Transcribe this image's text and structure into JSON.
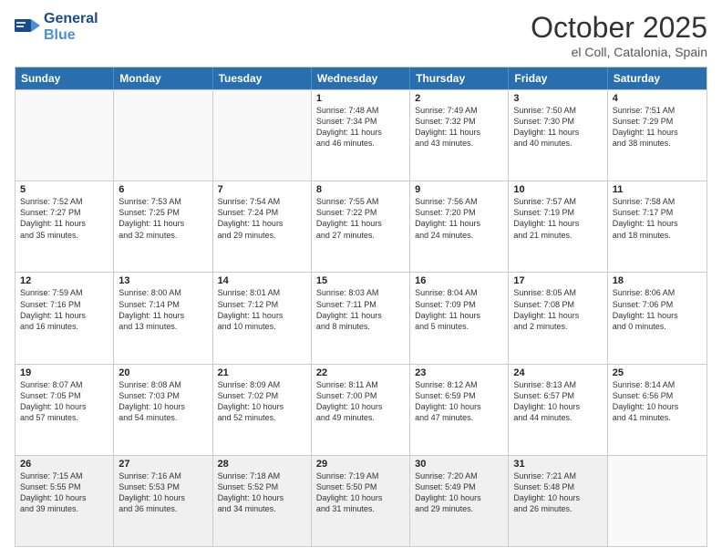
{
  "header": {
    "logo_line1": "General",
    "logo_line2": "Blue",
    "month": "October 2025",
    "location": "el Coll, Catalonia, Spain"
  },
  "weekdays": [
    "Sunday",
    "Monday",
    "Tuesday",
    "Wednesday",
    "Thursday",
    "Friday",
    "Saturday"
  ],
  "rows": [
    [
      {
        "num": "",
        "info": "",
        "empty": true
      },
      {
        "num": "",
        "info": "",
        "empty": true
      },
      {
        "num": "",
        "info": "",
        "empty": true
      },
      {
        "num": "1",
        "info": "Sunrise: 7:48 AM\nSunset: 7:34 PM\nDaylight: 11 hours\nand 46 minutes."
      },
      {
        "num": "2",
        "info": "Sunrise: 7:49 AM\nSunset: 7:32 PM\nDaylight: 11 hours\nand 43 minutes."
      },
      {
        "num": "3",
        "info": "Sunrise: 7:50 AM\nSunset: 7:30 PM\nDaylight: 11 hours\nand 40 minutes."
      },
      {
        "num": "4",
        "info": "Sunrise: 7:51 AM\nSunset: 7:29 PM\nDaylight: 11 hours\nand 38 minutes."
      }
    ],
    [
      {
        "num": "5",
        "info": "Sunrise: 7:52 AM\nSunset: 7:27 PM\nDaylight: 11 hours\nand 35 minutes."
      },
      {
        "num": "6",
        "info": "Sunrise: 7:53 AM\nSunset: 7:25 PM\nDaylight: 11 hours\nand 32 minutes."
      },
      {
        "num": "7",
        "info": "Sunrise: 7:54 AM\nSunset: 7:24 PM\nDaylight: 11 hours\nand 29 minutes."
      },
      {
        "num": "8",
        "info": "Sunrise: 7:55 AM\nSunset: 7:22 PM\nDaylight: 11 hours\nand 27 minutes."
      },
      {
        "num": "9",
        "info": "Sunrise: 7:56 AM\nSunset: 7:20 PM\nDaylight: 11 hours\nand 24 minutes."
      },
      {
        "num": "10",
        "info": "Sunrise: 7:57 AM\nSunset: 7:19 PM\nDaylight: 11 hours\nand 21 minutes."
      },
      {
        "num": "11",
        "info": "Sunrise: 7:58 AM\nSunset: 7:17 PM\nDaylight: 11 hours\nand 18 minutes."
      }
    ],
    [
      {
        "num": "12",
        "info": "Sunrise: 7:59 AM\nSunset: 7:16 PM\nDaylight: 11 hours\nand 16 minutes."
      },
      {
        "num": "13",
        "info": "Sunrise: 8:00 AM\nSunset: 7:14 PM\nDaylight: 11 hours\nand 13 minutes."
      },
      {
        "num": "14",
        "info": "Sunrise: 8:01 AM\nSunset: 7:12 PM\nDaylight: 11 hours\nand 10 minutes."
      },
      {
        "num": "15",
        "info": "Sunrise: 8:03 AM\nSunset: 7:11 PM\nDaylight: 11 hours\nand 8 minutes."
      },
      {
        "num": "16",
        "info": "Sunrise: 8:04 AM\nSunset: 7:09 PM\nDaylight: 11 hours\nand 5 minutes."
      },
      {
        "num": "17",
        "info": "Sunrise: 8:05 AM\nSunset: 7:08 PM\nDaylight: 11 hours\nand 2 minutes."
      },
      {
        "num": "18",
        "info": "Sunrise: 8:06 AM\nSunset: 7:06 PM\nDaylight: 11 hours\nand 0 minutes."
      }
    ],
    [
      {
        "num": "19",
        "info": "Sunrise: 8:07 AM\nSunset: 7:05 PM\nDaylight: 10 hours\nand 57 minutes."
      },
      {
        "num": "20",
        "info": "Sunrise: 8:08 AM\nSunset: 7:03 PM\nDaylight: 10 hours\nand 54 minutes."
      },
      {
        "num": "21",
        "info": "Sunrise: 8:09 AM\nSunset: 7:02 PM\nDaylight: 10 hours\nand 52 minutes."
      },
      {
        "num": "22",
        "info": "Sunrise: 8:11 AM\nSunset: 7:00 PM\nDaylight: 10 hours\nand 49 minutes."
      },
      {
        "num": "23",
        "info": "Sunrise: 8:12 AM\nSunset: 6:59 PM\nDaylight: 10 hours\nand 47 minutes."
      },
      {
        "num": "24",
        "info": "Sunrise: 8:13 AM\nSunset: 6:57 PM\nDaylight: 10 hours\nand 44 minutes."
      },
      {
        "num": "25",
        "info": "Sunrise: 8:14 AM\nSunset: 6:56 PM\nDaylight: 10 hours\nand 41 minutes."
      }
    ],
    [
      {
        "num": "26",
        "info": "Sunrise: 7:15 AM\nSunset: 5:55 PM\nDaylight: 10 hours\nand 39 minutes."
      },
      {
        "num": "27",
        "info": "Sunrise: 7:16 AM\nSunset: 5:53 PM\nDaylight: 10 hours\nand 36 minutes."
      },
      {
        "num": "28",
        "info": "Sunrise: 7:18 AM\nSunset: 5:52 PM\nDaylight: 10 hours\nand 34 minutes."
      },
      {
        "num": "29",
        "info": "Sunrise: 7:19 AM\nSunset: 5:50 PM\nDaylight: 10 hours\nand 31 minutes."
      },
      {
        "num": "30",
        "info": "Sunrise: 7:20 AM\nSunset: 5:49 PM\nDaylight: 10 hours\nand 29 minutes."
      },
      {
        "num": "31",
        "info": "Sunrise: 7:21 AM\nSunset: 5:48 PM\nDaylight: 10 hours\nand 26 minutes."
      },
      {
        "num": "",
        "info": "",
        "empty": true
      }
    ]
  ]
}
